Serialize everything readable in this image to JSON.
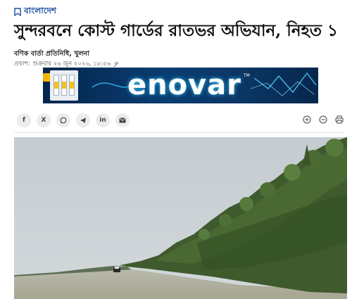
{
  "category": {
    "label": "বাংলাদেশ",
    "icon": "bookmark-icon",
    "color": "#1a4fa0"
  },
  "article": {
    "headline": "সুন্দরবনে কোস্ট গার্ডের রাতভর অভিযান, নিহত ১",
    "byline": "বণিক বার্তা প্রতিনিধি, খুলনা",
    "published_label": "প্রকাশ:",
    "published_value": "শুক্রবার ২৬ জুন ২০২৬, ১৮:৫৬",
    "published_icon": "attachment-icon"
  },
  "ad": {
    "brand": "enovar",
    "trademark": "TM"
  },
  "share": {
    "buttons": [
      {
        "name": "facebook",
        "glyph": "f"
      },
      {
        "name": "x",
        "glyph": "X"
      },
      {
        "name": "whatsapp",
        "glyph": ""
      },
      {
        "name": "telegram",
        "glyph": ""
      },
      {
        "name": "linkedin",
        "glyph": "in"
      },
      {
        "name": "email",
        "glyph": ""
      }
    ]
  },
  "tools": [
    "zoom-in-icon",
    "zoom-out-icon",
    "print-icon"
  ]
}
